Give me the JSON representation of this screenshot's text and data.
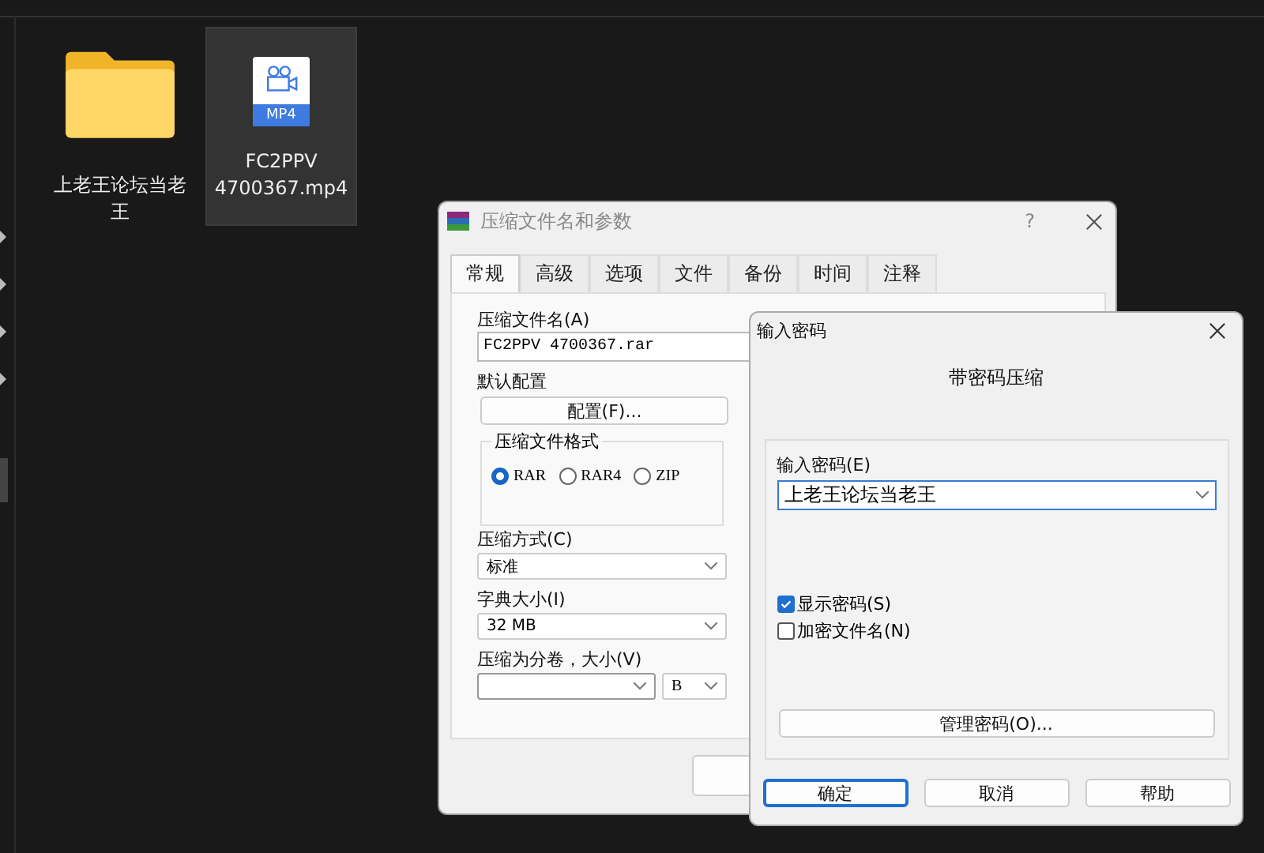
{
  "desktop_items": [
    {
      "kind": "folder",
      "label": "上老王论坛当老王",
      "selected": false
    },
    {
      "kind": "video",
      "label": "FC2PPV 4700367.mp4",
      "icon_text": "MP4",
      "selected": true
    }
  ],
  "archive_dialog": {
    "title": "压缩文件名和参数",
    "help": "?",
    "tabs": [
      {
        "label": "常规",
        "selected": true
      },
      {
        "label": "高级",
        "selected": false
      },
      {
        "label": "选项",
        "selected": false
      },
      {
        "label": "文件",
        "selected": false
      },
      {
        "label": "备份",
        "selected": false
      },
      {
        "label": "时间",
        "selected": false
      },
      {
        "label": "注释",
        "selected": false
      }
    ],
    "archive_name_label": "压缩文件名(A)",
    "archive_name": "FC2PPV 4700367.rar",
    "profile_label": "默认配置",
    "profile_button": "配置(F)...",
    "format_group": "压缩文件格式",
    "formats": [
      {
        "label": "RAR",
        "selected": true
      },
      {
        "label": "RAR4",
        "selected": false
      },
      {
        "label": "ZIP",
        "selected": false
      }
    ],
    "method_label": "压缩方式(C)",
    "method": "标准",
    "dictionary_label": "字典大小(I)",
    "dictionary": "32 MB",
    "split_label": "压缩为分卷，大小(V)",
    "split_unit": "B"
  },
  "password_dialog": {
    "title": "输入密码",
    "heading": "带密码压缩",
    "password_label": "输入密码(E)",
    "password": "上老王论坛当老王",
    "options": [
      {
        "label": "显示密码(S)",
        "checked": true
      },
      {
        "label": "加密文件名(N)",
        "checked": false
      }
    ],
    "manage_button": "管理密码(O)...",
    "buttons": [
      {
        "label": "确定",
        "kind": "default"
      },
      {
        "label": "取消",
        "kind": "normal"
      },
      {
        "label": "帮助",
        "kind": "normal"
      }
    ]
  }
}
